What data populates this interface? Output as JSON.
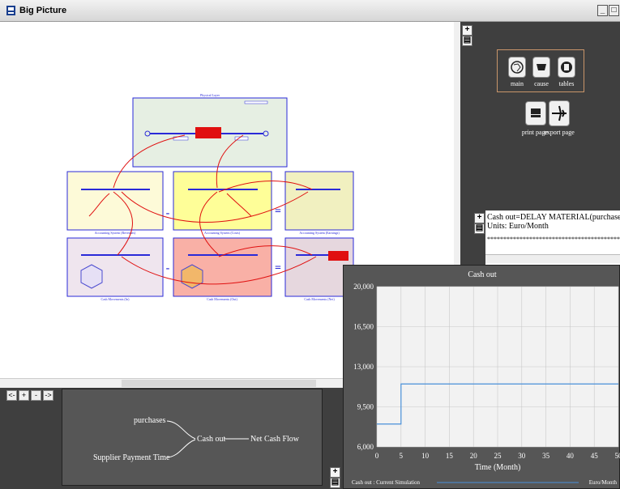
{
  "window": {
    "title": "Big Picture",
    "minimize": "_",
    "restore": "□"
  },
  "diagram": {
    "layers": [
      {
        "title": "Physical Layer"
      },
      {
        "title": "Accounting System (Revenues)"
      },
      {
        "title": "Accounting System (Costs)"
      },
      {
        "title": "Accounting System (Earnings)"
      },
      {
        "title": "Cash Movements (In)"
      },
      {
        "title": "Cash Movements (Out)"
      },
      {
        "title": "Cash Movements (Net)"
      }
    ],
    "operators": [
      "-",
      "=",
      "-",
      "="
    ]
  },
  "tools": {
    "items": [
      {
        "label": "main",
        "icon": "globe-icon"
      },
      {
        "label": "cause",
        "icon": "cause-icon"
      },
      {
        "label": "tables",
        "icon": "tables-icon"
      }
    ],
    "print_label": "print page",
    "export_label": "export page"
  },
  "equation": {
    "line1": "Cash out=DELAY MATERIAL(purchases,Supplie",
    "line2": "Units: Euro/Month",
    "stars": "********************************************"
  },
  "tree": {
    "left1": "purchases",
    "left2": "Supplier Payment Time",
    "middle": "Cash out",
    "right": "Net Cash Flow"
  },
  "navigation": [
    "<-",
    "+",
    "-",
    "->"
  ],
  "chart_data": {
    "type": "line",
    "title": "Cash out",
    "xlabel": "Time (Month)",
    "ylabel": "",
    "xlim": [
      0,
      50
    ],
    "ylim": [
      6000,
      20000
    ],
    "x_ticks": [
      0,
      5,
      10,
      15,
      20,
      25,
      30,
      35,
      40,
      45,
      50
    ],
    "y_ticks": [
      6000,
      9500,
      13000,
      16500,
      20000
    ],
    "y_tick_labels": [
      "6,000",
      "9,500",
      "13,000",
      "16,500",
      "20,000"
    ],
    "grid": true,
    "series": [
      {
        "name": "Cash out : Current Simulation",
        "color": "#4a90d9",
        "x": [
          0,
          5,
          5,
          50
        ],
        "y": [
          8000,
          8000,
          11500,
          11500
        ]
      }
    ],
    "legend_label": "Cash out : Current Simulation",
    "legend_units": "Euro/Month"
  }
}
